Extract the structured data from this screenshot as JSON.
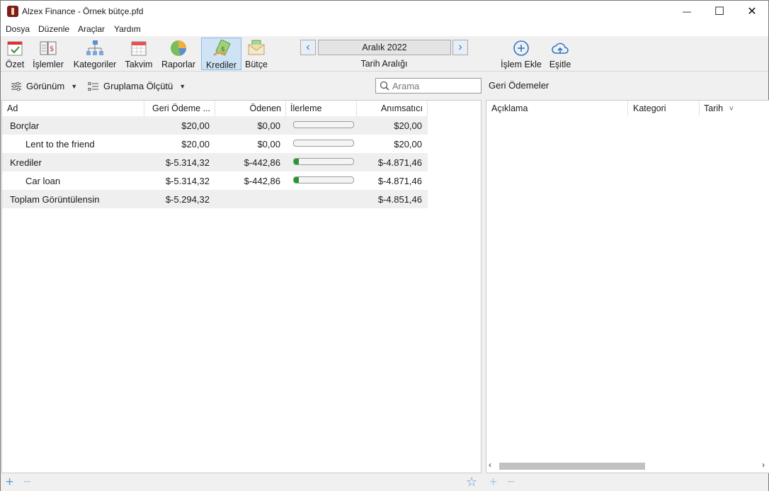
{
  "window": {
    "title": "Alzex Finance - Örnek bütçe.pfd",
    "controls": {
      "minimize": "—",
      "maximize": "☐",
      "close": "✕"
    }
  },
  "menu": [
    "Dosya",
    "Düzenle",
    "Araçlar",
    "Yardım"
  ],
  "toolbar": {
    "buttons": [
      {
        "label": "Özet",
        "icon": "summary-icon"
      },
      {
        "label": "İşlemler",
        "icon": "transactions-icon"
      },
      {
        "label": "Kategoriler",
        "icon": "categories-icon"
      },
      {
        "label": "Takvim",
        "icon": "calendar-icon"
      },
      {
        "label": "Raporlar",
        "icon": "pie-chart-icon"
      },
      {
        "label": "Krediler",
        "icon": "loans-icon",
        "active": true
      },
      {
        "label": "Bütçe",
        "icon": "budget-icon"
      }
    ],
    "date_range": {
      "value": "Aralık 2022",
      "caption": "Tarih Aralığı",
      "prev": "‹",
      "next": "›"
    },
    "add_transaction": "İşlem Ekle",
    "sync": "Eşitle"
  },
  "viewbar": {
    "view_label": "Görünüm",
    "group_label": "Gruplama Ölçütü",
    "search_placeholder": "Arama",
    "right_panel_title": "Geri Ödemeler"
  },
  "loans_table": {
    "columns": [
      "Ad",
      "Geri Ödeme ...",
      "Ödenen",
      "İlerleme",
      "Anımsatıcı"
    ],
    "rows": [
      {
        "name": "Borçlar",
        "repayment": "$20,00",
        "paid": "$0,00",
        "progress": 0.0,
        "reminder": "$20,00",
        "level": 0
      },
      {
        "name": "Lent to the friend",
        "repayment": "$20,00",
        "paid": "$0,00",
        "progress": 0.0,
        "reminder": "$20,00",
        "level": 1
      },
      {
        "name": "Krediler",
        "repayment": "$-5.314,32",
        "paid": "$-442,86",
        "progress": 0.08,
        "reminder": "$-4.871,46",
        "level": 0
      },
      {
        "name": "Car loan",
        "repayment": "$-5.314,32",
        "paid": "$-442,86",
        "progress": 0.08,
        "reminder": "$-4.871,46",
        "level": 1
      },
      {
        "name": "Toplam Görüntülensin",
        "repayment": "$-5.294,32",
        "paid": "",
        "progress": null,
        "reminder": "$-4.851,46",
        "level": 0
      }
    ]
  },
  "repayments_table": {
    "columns": [
      "Açıklama",
      "Kategori",
      "Tarih"
    ],
    "sort_indicator": "˅"
  },
  "statusbar": {
    "add": "+",
    "remove": "−",
    "favorite": "☆"
  },
  "colors": {
    "accent": "#2d78c8",
    "progress_fill": "#1f9a2e",
    "active_tab": "#cfe3f7"
  }
}
